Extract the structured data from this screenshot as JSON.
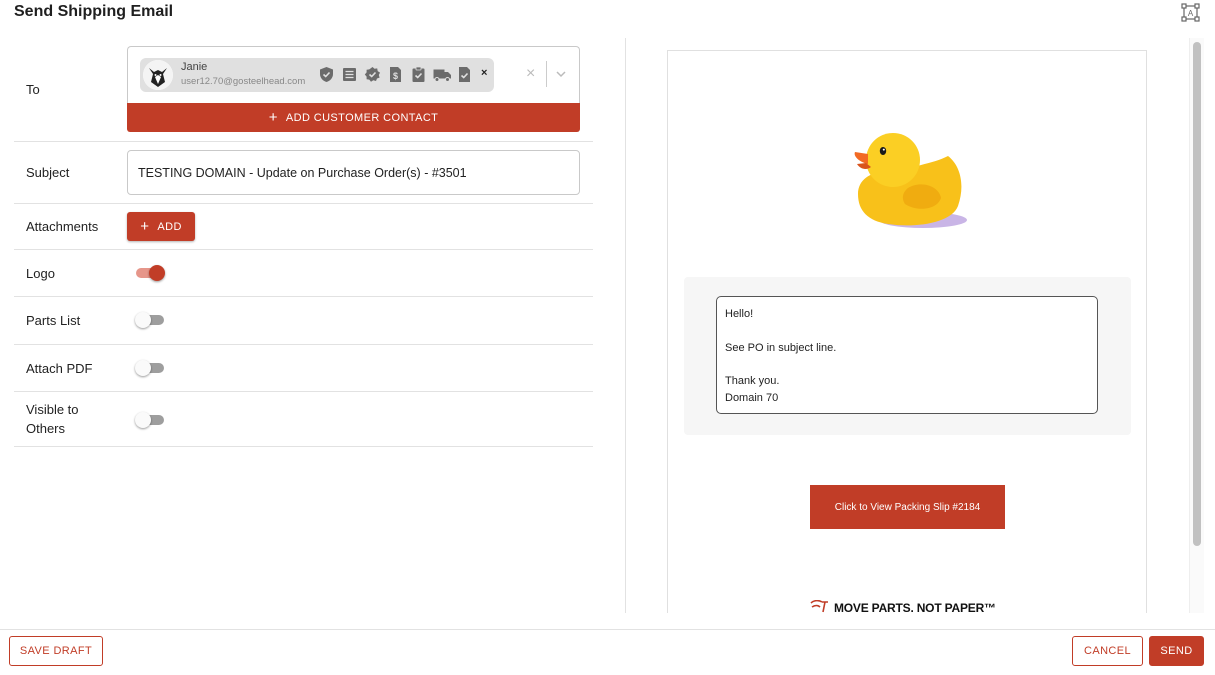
{
  "dialog": {
    "title": "Send Shipping Email"
  },
  "form": {
    "to": {
      "label": "To",
      "contact": {
        "name": "Janie",
        "email": "user12.70@gosteelhead.com"
      },
      "chip_icons": [
        "shield-check-icon",
        "list-icon",
        "badge-check-icon",
        "invoice-dollar-icon",
        "clipboard-check-icon",
        "truck-icon",
        "document-check-icon"
      ],
      "add_contact_label": "ADD CUSTOMER CONTACT"
    },
    "subject": {
      "label": "Subject",
      "value": "TESTING DOMAIN - Update on Purchase Order(s) - #3501"
    },
    "attachments": {
      "label": "Attachments",
      "add_label": "ADD"
    },
    "logo": {
      "label": "Logo",
      "on": true
    },
    "parts_list": {
      "label": "Parts List",
      "on": false
    },
    "attach_pdf": {
      "label": "Attach PDF",
      "on": false
    },
    "visible_to_others": {
      "label_line1": "Visible to",
      "label_line2": "Others",
      "on": false
    }
  },
  "preview": {
    "message_lines": [
      "Hello!",
      "",
      "See PO in subject line.",
      "",
      "Thank you.",
      "Domain 70"
    ],
    "packing_slip_button": "Click to View Packing Slip #2184",
    "tagline": "MOVE PARTS. NOT PAPER™"
  },
  "footer": {
    "save_draft": "SAVE DRAFT",
    "cancel": "CANCEL",
    "send": "SEND"
  },
  "colors": {
    "accent": "#c13d27"
  }
}
